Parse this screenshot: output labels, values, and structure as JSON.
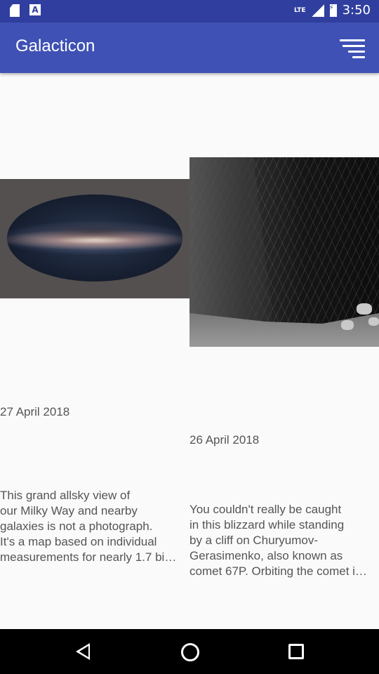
{
  "status_bar": {
    "time": "3:50",
    "network": "LTE",
    "icons": [
      "sd-card-icon",
      "a-icon",
      "signal-icon",
      "battery-icon"
    ]
  },
  "app_bar": {
    "title": "Galacticon",
    "action_icon": "filter-icon",
    "background": "#3f51b5",
    "status_background": "#303f9f"
  },
  "cards": [
    {
      "date": "27 April 2018",
      "description": "This grand allsky view of\nour Milky Way and nearby\ngalaxies is not a photograph.\nIt's a map based on individual\nmeasurements for nearly 1.7 bi…"
    },
    {
      "date": "26 April 2018",
      "description": "You couldn't really be caught\nin this blizzard while standing\nby a cliff on Churyumov-\nGerasimenko, also known as\ncomet 67P. Orbiting the comet i…"
    }
  ],
  "nav_bar": {
    "icons": [
      "back-icon",
      "home-icon",
      "recent-apps-icon"
    ]
  }
}
